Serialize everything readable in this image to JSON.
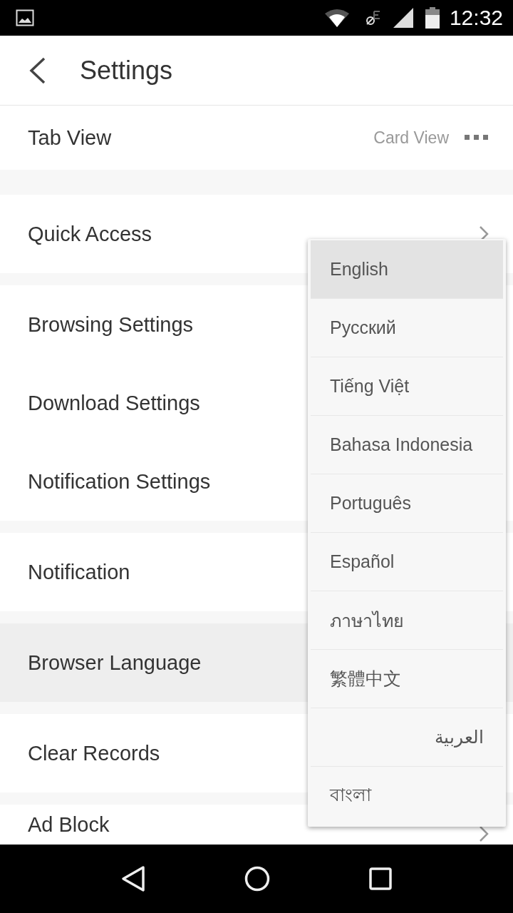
{
  "status_bar": {
    "time": "12:32"
  },
  "header": {
    "title": "Settings"
  },
  "tab_view": {
    "label": "Tab View",
    "value": "Card View"
  },
  "groups": [
    {
      "rows": [
        {
          "label": "Quick Access",
          "selected": false,
          "kind": "chevron"
        }
      ]
    },
    {
      "rows": [
        {
          "label": "Browsing Settings",
          "selected": false,
          "kind": "plain"
        },
        {
          "label": "Download Settings",
          "selected": false,
          "kind": "plain"
        },
        {
          "label": "Notification Settings",
          "selected": false,
          "kind": "plain"
        }
      ]
    },
    {
      "rows": [
        {
          "label": "Notification",
          "selected": false,
          "kind": "plain"
        }
      ]
    },
    {
      "rows": [
        {
          "label": "Browser Language",
          "selected": true,
          "kind": "plain"
        }
      ]
    },
    {
      "rows": [
        {
          "label": "Clear Records",
          "selected": false,
          "kind": "plain"
        }
      ]
    },
    {
      "rows": [
        {
          "label": "Ad Block",
          "selected": false,
          "kind": "chevron"
        }
      ]
    }
  ],
  "language_menu": [
    {
      "label": "English",
      "selected": true
    },
    {
      "label": "Русский",
      "selected": false
    },
    {
      "label": "Tiếng Việt",
      "selected": false
    },
    {
      "label": "Bahasa Indonesia",
      "selected": false
    },
    {
      "label": "Português",
      "selected": false
    },
    {
      "label": "Español",
      "selected": false
    },
    {
      "label": "ภาษาไทย",
      "selected": false
    },
    {
      "label": "繁體中文",
      "selected": false
    },
    {
      "label": "العربية",
      "selected": false
    },
    {
      "label": "বাংলা",
      "selected": false
    }
  ]
}
